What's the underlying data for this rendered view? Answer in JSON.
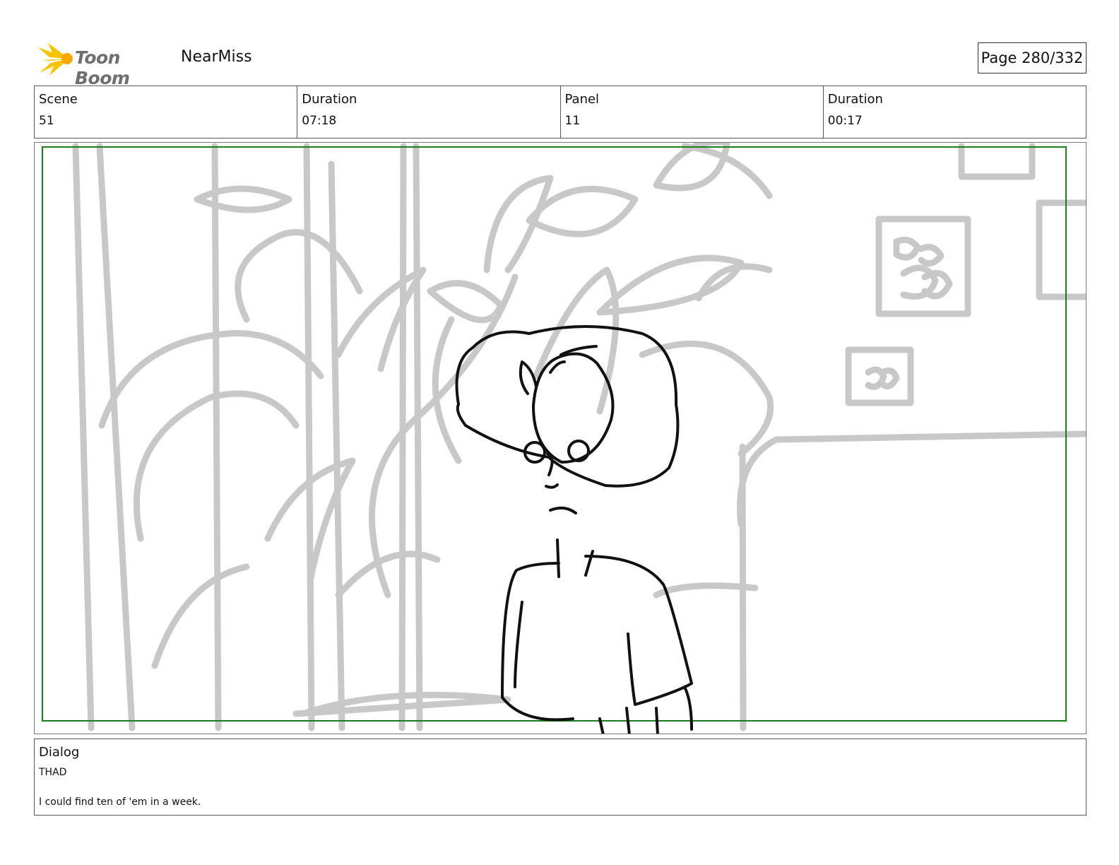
{
  "header": {
    "logo_text": "Toon Boom",
    "project": "NearMiss",
    "page": "Page 280/332"
  },
  "info": {
    "scene_label": "Scene",
    "scene": "51",
    "scene_duration_label": "Duration",
    "scene_duration": "07:18",
    "panel_label": "Panel",
    "panel": "11",
    "panel_duration_label": "Duration",
    "panel_duration": "00:17"
  },
  "dialog": {
    "label": "Dialog",
    "character": "THAD",
    "line": "I could find ten of 'em in a week."
  },
  "colors": {
    "frame_green": "#1f7a1f",
    "background_sketch": "#c8c8c8",
    "character_line": "#111111",
    "logo_yellow": "#f5c400"
  }
}
